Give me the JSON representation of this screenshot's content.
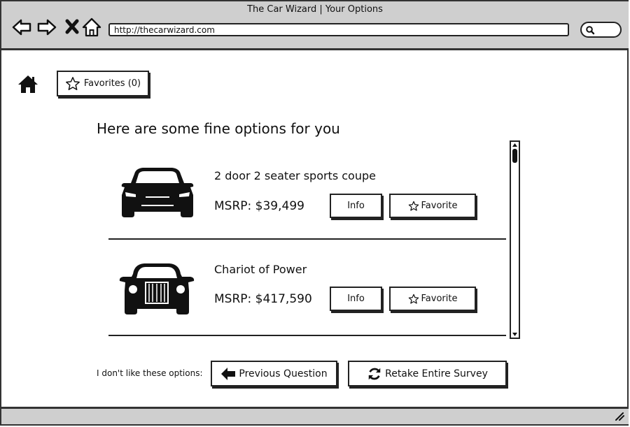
{
  "browser": {
    "title": "The Car Wizard | Your Options",
    "url": "http://thecarwizard.com"
  },
  "top": {
    "favorites_label": "Favorites (0)"
  },
  "main": {
    "heading": "Here are some fine options for you",
    "cars": [
      {
        "name": "2 door 2 seater sports coupe",
        "price": "MSRP: $39,499",
        "info_label": "Info",
        "favorite_label": "Favorite"
      },
      {
        "name": "Chariot of Power",
        "price": "MSRP: $417,590",
        "info_label": "Info",
        "favorite_label": "Favorite"
      }
    ]
  },
  "footer": {
    "prompt": "I don't like these options:",
    "previous_label": "Previous Question",
    "retake_label": "Retake Entire Survey"
  },
  "icons": {
    "back": "back-arrow-icon",
    "forward": "forward-arrow-icon",
    "stop": "close-icon",
    "home_browser": "home-icon",
    "search": "search-icon",
    "home": "home-icon",
    "star": "star-icon",
    "arrow_left": "arrow-left-icon",
    "refresh": "refresh-icon",
    "resize": "resize-grip-icon"
  }
}
